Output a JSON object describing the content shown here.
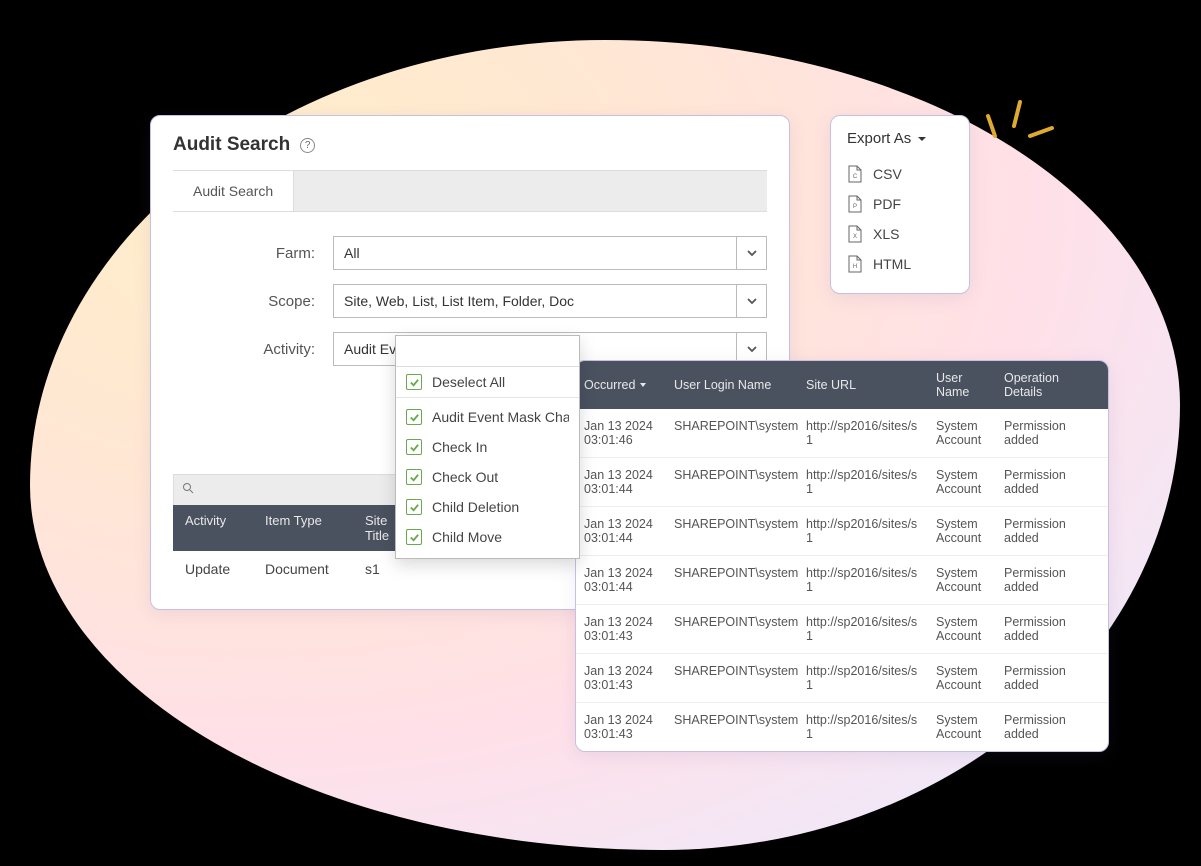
{
  "audit": {
    "title": "Audit Search",
    "tab": "Audit Search",
    "fields": {
      "farm": {
        "label": "Farm:",
        "value": "All"
      },
      "scope": {
        "label": "Scope:",
        "value": "Site, Web, List, List Item, Folder, Doc"
      },
      "activity": {
        "label": "Activity:",
        "value": "Audit Event Mask Changes, Check In,"
      }
    },
    "activity_options": {
      "deselect": "Deselect All",
      "items": [
        "Audit Event Mask Changes",
        "Check In",
        "Check Out",
        "Child Deletion",
        "Child Move"
      ]
    },
    "mini_table": {
      "headers": [
        "Activity",
        "Item Type",
        "Site Title"
      ],
      "row": [
        "Update",
        "Document",
        "s1"
      ]
    }
  },
  "export": {
    "title": "Export As",
    "items": [
      "CSV",
      "PDF",
      "XLS",
      "HTML"
    ]
  },
  "results": {
    "headers": {
      "occurred": "Occurred",
      "login": "User Login Name",
      "url": "Site URL",
      "uname": "User Name",
      "op": "Operation Details"
    },
    "rows": [
      {
        "occ": "Jan 13 2024 03:01:46",
        "login": "SHAREPOINT\\system",
        "url": "http://sp2016/sites/s1",
        "uname": "System Account",
        "op": "Permission added"
      },
      {
        "occ": "Jan 13 2024 03:01:44",
        "login": "SHAREPOINT\\system",
        "url": "http://sp2016/sites/s1",
        "uname": "System Account",
        "op": "Permission added"
      },
      {
        "occ": "Jan 13 2024 03:01:44",
        "login": "SHAREPOINT\\system",
        "url": "http://sp2016/sites/s1",
        "uname": "System Account",
        "op": "Permission added"
      },
      {
        "occ": "Jan 13 2024 03:01:44",
        "login": "SHAREPOINT\\system",
        "url": "http://sp2016/sites/s1",
        "uname": "System Account",
        "op": "Permission added"
      },
      {
        "occ": "Jan 13 2024 03:01:43",
        "login": "SHAREPOINT\\system",
        "url": "http://sp2016/sites/s1",
        "uname": "System Account",
        "op": "Permission added"
      },
      {
        "occ": "Jan 13 2024 03:01:43",
        "login": "SHAREPOINT\\system",
        "url": "http://sp2016/sites/s1",
        "uname": "System Account",
        "op": "Permission added"
      },
      {
        "occ": "Jan 13 2024 03:01:43",
        "login": "SHAREPOINT\\system",
        "url": "http://sp2016/sites/s1",
        "uname": "System Account",
        "op": "Permission added"
      }
    ]
  }
}
